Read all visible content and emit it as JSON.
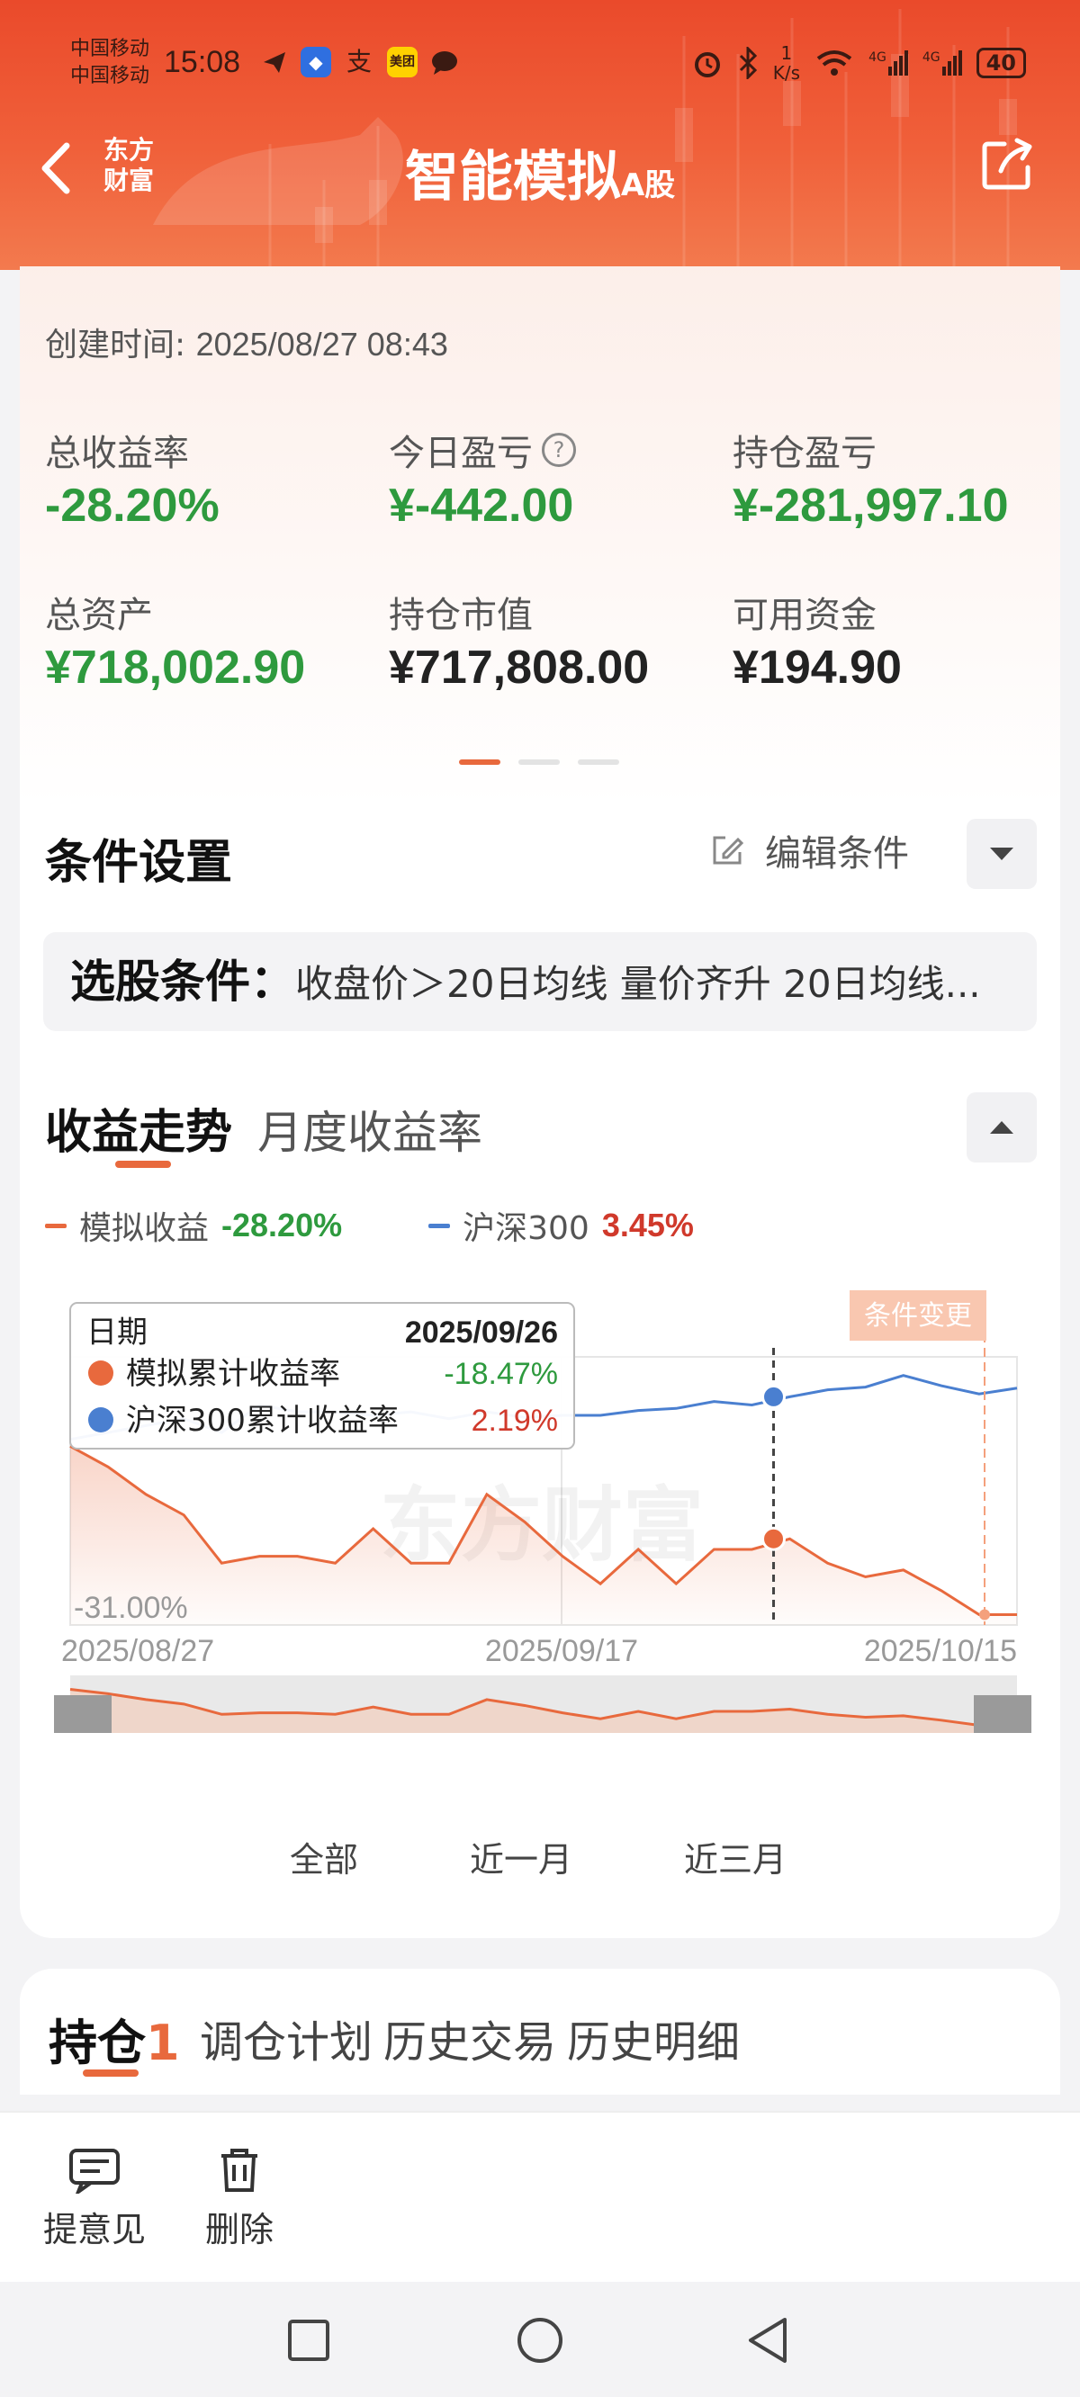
{
  "status_bar": {
    "carrier_1": "中国移动",
    "carrier_2": "中国移动",
    "time": "15:08",
    "speed_value": "1",
    "speed_unit": "K/s",
    "network_1": "4G",
    "network_2": "4G",
    "battery": "40",
    "app_icons": [
      "send-icon",
      "shield-icon",
      "alipay-icon",
      "meituan-icon",
      "chat-bubble-icon"
    ],
    "right_icons": [
      "alarm-icon",
      "bluetooth-icon",
      "wifi-icon",
      "signal-icon"
    ]
  },
  "nav": {
    "logo_line1": "东方",
    "logo_line2": "财富",
    "title": "智能模拟",
    "title_suffix": "A股"
  },
  "account": {
    "created_label": "创建时间:",
    "created_value": "2025/08/27 08:43",
    "stats": [
      {
        "label": "总收益率",
        "value": "-28.20%",
        "color": "#2e9a3e"
      },
      {
        "label": "今日盈亏",
        "value": "¥-442.00",
        "color": "#2e9a3e"
      },
      {
        "label": "持仓盈亏",
        "value": "¥-281,997.10",
        "color": "#2e9a3e"
      },
      {
        "label": "总资产",
        "value": "¥718,002.90",
        "color": "#2e9a3e"
      },
      {
        "label": "持仓市值",
        "value": "¥717,808.00",
        "color": "#222222"
      },
      {
        "label": "可用资金",
        "value": "¥194.90",
        "color": "#222222"
      }
    ],
    "help_icon": "?"
  },
  "conditions": {
    "title": "条件设置",
    "edit_label": "编辑条件",
    "prefix": "选股条件：",
    "text": "收盘价＞20日均线 量价齐升 20日均线..."
  },
  "trend": {
    "tab_active": "收益走势",
    "tab_other": "月度收益率",
    "legend": [
      {
        "name": "模拟收益",
        "value": "-28.20%",
        "line_color": "#e8693d",
        "value_color": "#2e9a3e"
      },
      {
        "name": "沪深300",
        "value": "3.45%",
        "line_color": "#4a7fd0",
        "value_color": "#d0392b"
      }
    ],
    "tooltip": {
      "date_label": "日期",
      "date_value": "2025/09/26",
      "rows": [
        {
          "name": "模拟累计收益率",
          "value": "-18.47%",
          "color": "#e8693d",
          "value_color": "#2e9a3e"
        },
        {
          "name": "沪深300累计收益率",
          "value": "2.19%",
          "color": "#4a7fd0",
          "value_color": "#d0392b"
        }
      ]
    },
    "marker_label": "条件变更",
    "y_min_label": "-31.00%",
    "watermark": "东方财富",
    "periods": [
      "全部",
      "近一月",
      "近三月"
    ]
  },
  "chart_data": {
    "type": "line",
    "x_tick_labels": [
      "2025/08/27",
      "2025/09/17",
      "2025/10/15"
    ],
    "y_tick_labels": [
      "-31.00%"
    ],
    "series": [
      {
        "name": "模拟收益",
        "color": "#e8693d",
        "values": [
          -5,
          -8,
          -12,
          -15,
          -22,
          -21,
          -21,
          -22,
          -17,
          -22,
          -22,
          -12,
          -16,
          -21,
          -25,
          -20,
          -25,
          -20,
          -20,
          -18.47,
          -22,
          -24,
          -23,
          -26,
          -29.5,
          -29.5
        ]
      },
      {
        "name": "沪深300",
        "color": "#4a7fd0",
        "values": [
          -4,
          -3,
          -2,
          -1,
          -3,
          1,
          0,
          0,
          -0.5,
          0,
          -1,
          0,
          -0.8,
          -0.5,
          -0.5,
          0.2,
          0.5,
          1.5,
          1,
          2.19,
          3.2,
          3.6,
          5.3,
          3.8,
          2.6,
          3.45
        ]
      }
    ],
    "tooltip_index": 19,
    "marker_index": 25,
    "ylim": [
      -31,
      8
    ]
  },
  "holdings": {
    "tabs": [
      {
        "label": "持仓",
        "count": "1"
      },
      {
        "label": "调仓计划"
      },
      {
        "label": "历史交易"
      },
      {
        "label": "历史明细"
      }
    ]
  },
  "bottom_actions": [
    {
      "label": "提意见",
      "icon": "feedback-icon"
    },
    {
      "label": "删除",
      "icon": "trash-icon"
    }
  ],
  "system_nav": [
    "recent-apps-icon",
    "home-icon",
    "back-icon"
  ]
}
